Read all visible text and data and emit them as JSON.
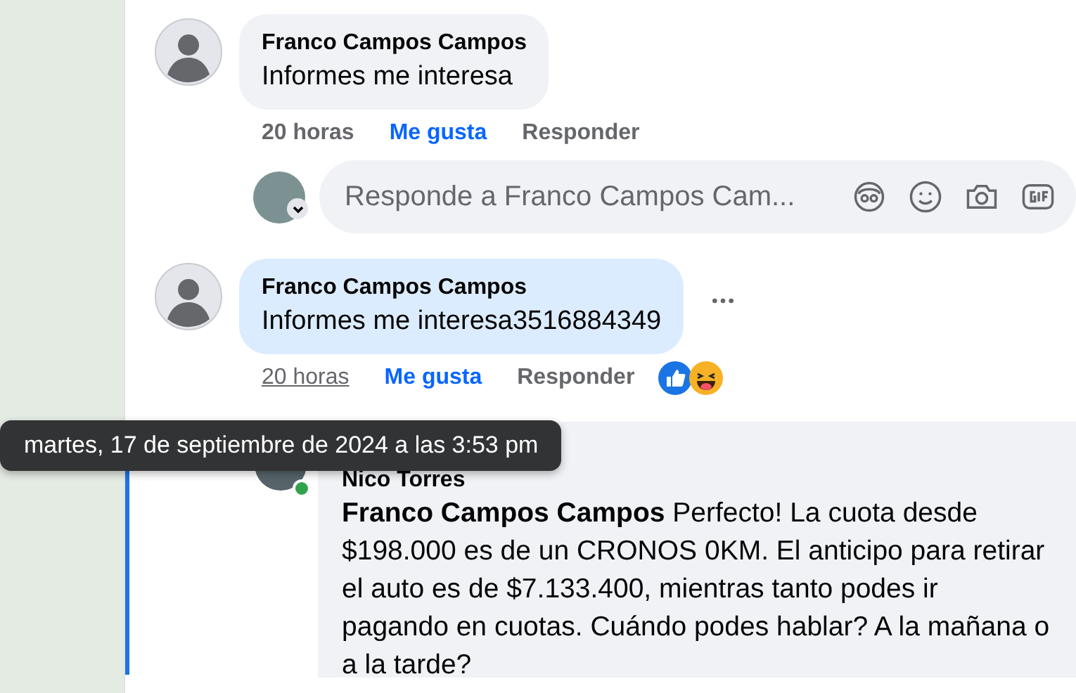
{
  "comments": [
    {
      "author": "Franco Campos Campos",
      "text": "Informes me interesa",
      "highlighted": false,
      "time": "20 horas",
      "time_hovered": false,
      "like": "Me gusta",
      "liked": true,
      "reply": "Responder"
    },
    {
      "author": "Franco Campos Campos",
      "text": "Informes me interesa3516884349",
      "highlighted": true,
      "more_menu": true,
      "time": "20 horas",
      "time_hovered": true,
      "like": "Me gusta",
      "liked": true,
      "reply": "Responder",
      "reactions": [
        {
          "kind": "like"
        },
        {
          "kind": "haha"
        }
      ]
    }
  ],
  "reply_box": {
    "placeholder": "Responde a Franco Campos Cam..."
  },
  "nested_reply": {
    "author": "Nico Torres",
    "online": true,
    "text": "**Franco Campos Campos** Perfecto! La cuota desde $198.000 es de un CRONOS 0KM. El anticipo para retirar el auto es de $7.133.400, mientras tanto podes ir pagando en cuotas. Cuándo podes hablar? A la mañana o a la tarde?"
  },
  "tooltip": {
    "text": "martes, 17 de septiembre de 2024 a las 3:53 pm"
  }
}
